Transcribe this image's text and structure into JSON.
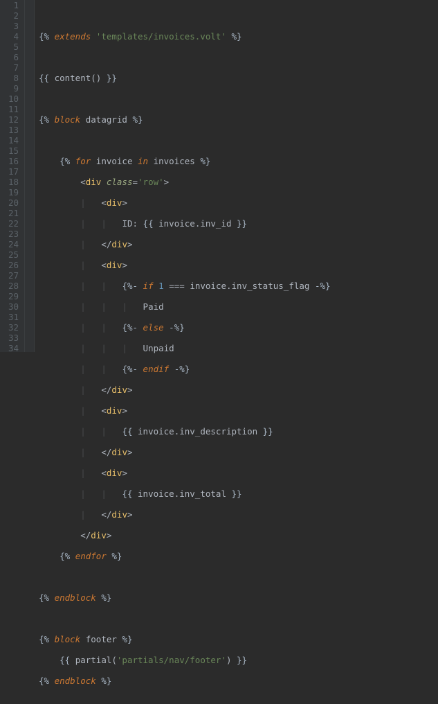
{
  "lines": {
    "1": {
      "num": "1"
    },
    "2": {
      "num": "2",
      "kw": "extends",
      "str": "'templates/invoices.volt'"
    },
    "3": {
      "num": "3"
    },
    "4": {
      "num": "4",
      "fn": "content"
    },
    "5": {
      "num": "5"
    },
    "6": {
      "num": "6",
      "kw": "block",
      "name": "datagrid"
    },
    "7": {
      "num": "7"
    },
    "8": {
      "num": "8",
      "kw_for": "for",
      "var": "invoice",
      "kw_in": "in",
      "coll": "invoices"
    },
    "9": {
      "num": "9",
      "tag": "div",
      "attr": "class",
      "val": "'row'"
    },
    "10": {
      "num": "10",
      "tag": "div"
    },
    "11": {
      "num": "11",
      "label": "ID:",
      "obj": "invoice",
      "prop": "inv_id"
    },
    "12": {
      "num": "12",
      "tag": "div"
    },
    "13": {
      "num": "13",
      "tag": "div"
    },
    "14": {
      "num": "14",
      "kw": "if",
      "lit": "1",
      "op": "===",
      "obj": "invoice",
      "prop": "inv_status_flag"
    },
    "15": {
      "num": "15",
      "txt": "Paid"
    },
    "16": {
      "num": "16",
      "kw": "else"
    },
    "17": {
      "num": "17",
      "txt": "Unpaid"
    },
    "18": {
      "num": "18",
      "kw": "endif"
    },
    "19": {
      "num": "19",
      "tag": "div"
    },
    "20": {
      "num": "20",
      "tag": "div"
    },
    "21": {
      "num": "21",
      "obj": "invoice",
      "prop": "inv_description"
    },
    "22": {
      "num": "22",
      "tag": "div"
    },
    "23": {
      "num": "23",
      "tag": "div"
    },
    "24": {
      "num": "24",
      "obj": "invoice",
      "prop": "inv_total"
    },
    "25": {
      "num": "25",
      "tag": "div"
    },
    "26": {
      "num": "26",
      "tag": "div"
    },
    "27": {
      "num": "27",
      "kw": "endfor"
    },
    "28": {
      "num": "28"
    },
    "29": {
      "num": "29",
      "kw": "endblock"
    },
    "30": {
      "num": "30"
    },
    "31": {
      "num": "31",
      "kw": "block",
      "name": "footer"
    },
    "32": {
      "num": "32",
      "fn": "partial",
      "arg": "'partials/nav/footer'"
    },
    "33": {
      "num": "33",
      "kw": "endblock"
    },
    "34": {
      "num": "34"
    }
  }
}
